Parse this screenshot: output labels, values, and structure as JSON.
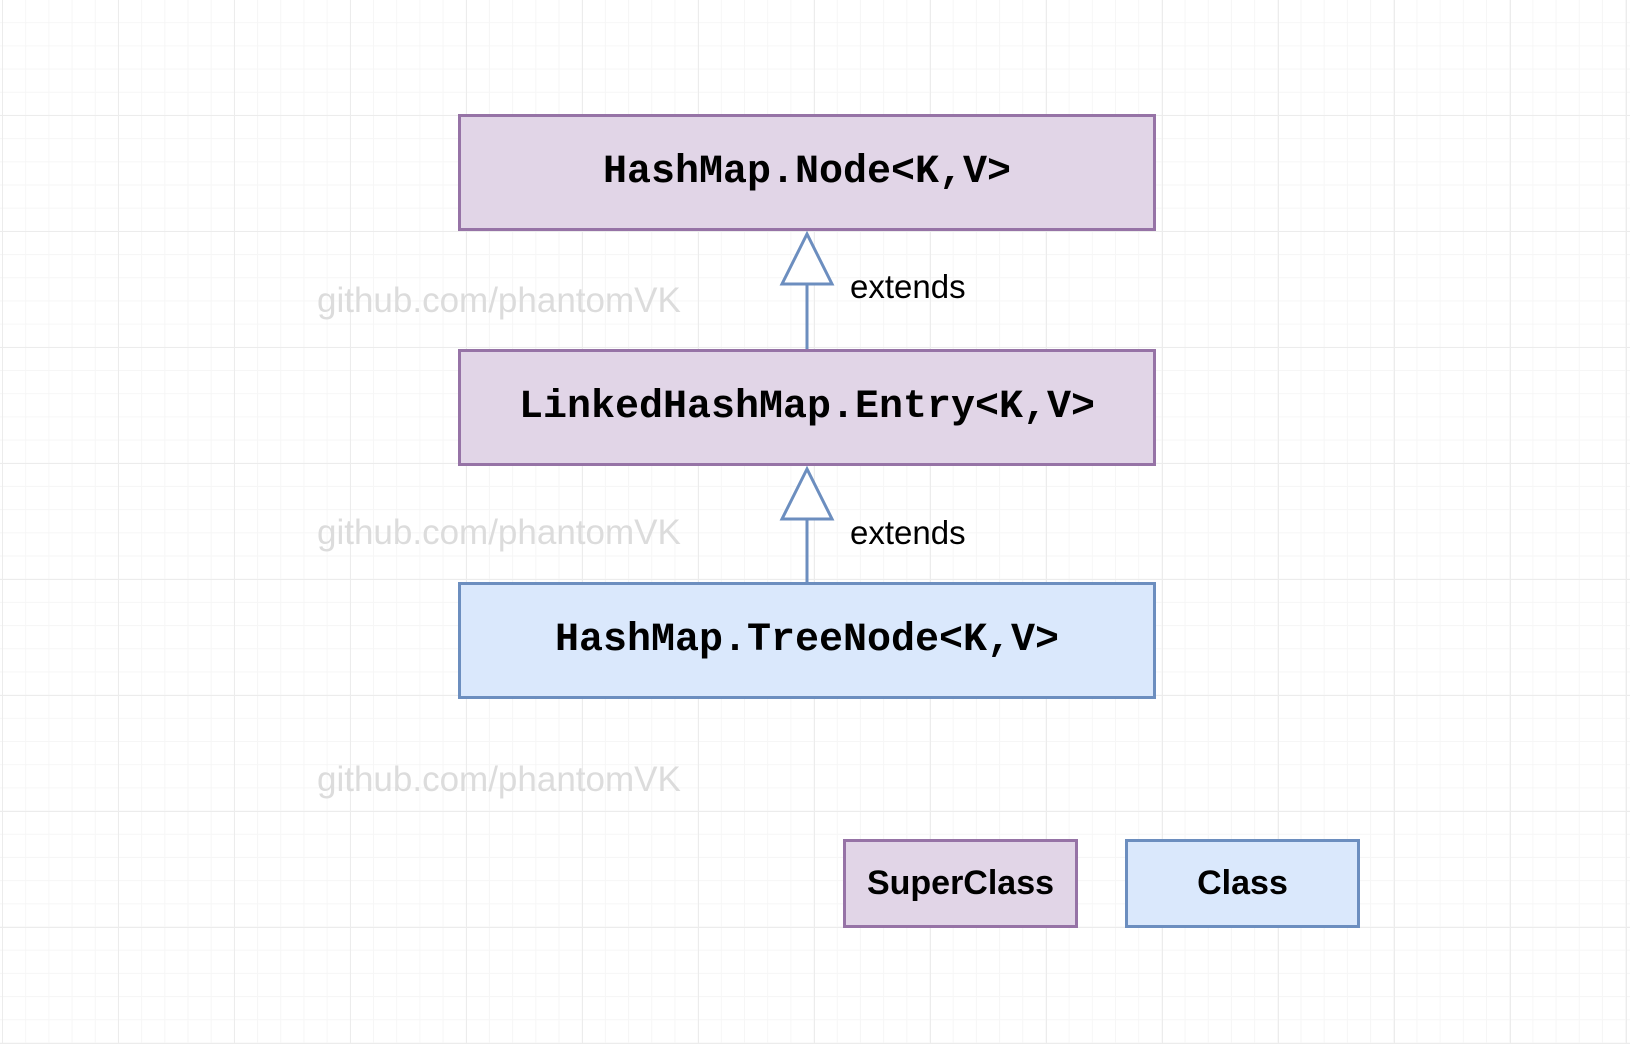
{
  "colors": {
    "superclass_fill": "#e1d5e7",
    "superclass_border": "#9673a6",
    "class_fill": "#dae8fc",
    "class_border": "#6c8ebf",
    "edge": "#6c8ebf",
    "watermark": "#dcdcdc"
  },
  "nodes": {
    "hashmap_node": {
      "label": "HashMap.Node<K,V>",
      "kind": "superclass"
    },
    "linked_entry": {
      "label": "LinkedHashMap.Entry<K,V>",
      "kind": "superclass"
    },
    "tree_node": {
      "label": "HashMap.TreeNode<K,V>",
      "kind": "class"
    }
  },
  "edges": [
    {
      "from": "linked_entry",
      "to": "hashmap_node",
      "label": "extends",
      "arrow": "hollow-triangle"
    },
    {
      "from": "tree_node",
      "to": "linked_entry",
      "label": "extends",
      "arrow": "hollow-triangle"
    }
  ],
  "legend": {
    "superclass_label": "SuperClass",
    "class_label": "Class"
  },
  "watermarks": [
    "github.com/phantomVK",
    "github.com/phantomVK",
    "github.com/phantomVK"
  ]
}
